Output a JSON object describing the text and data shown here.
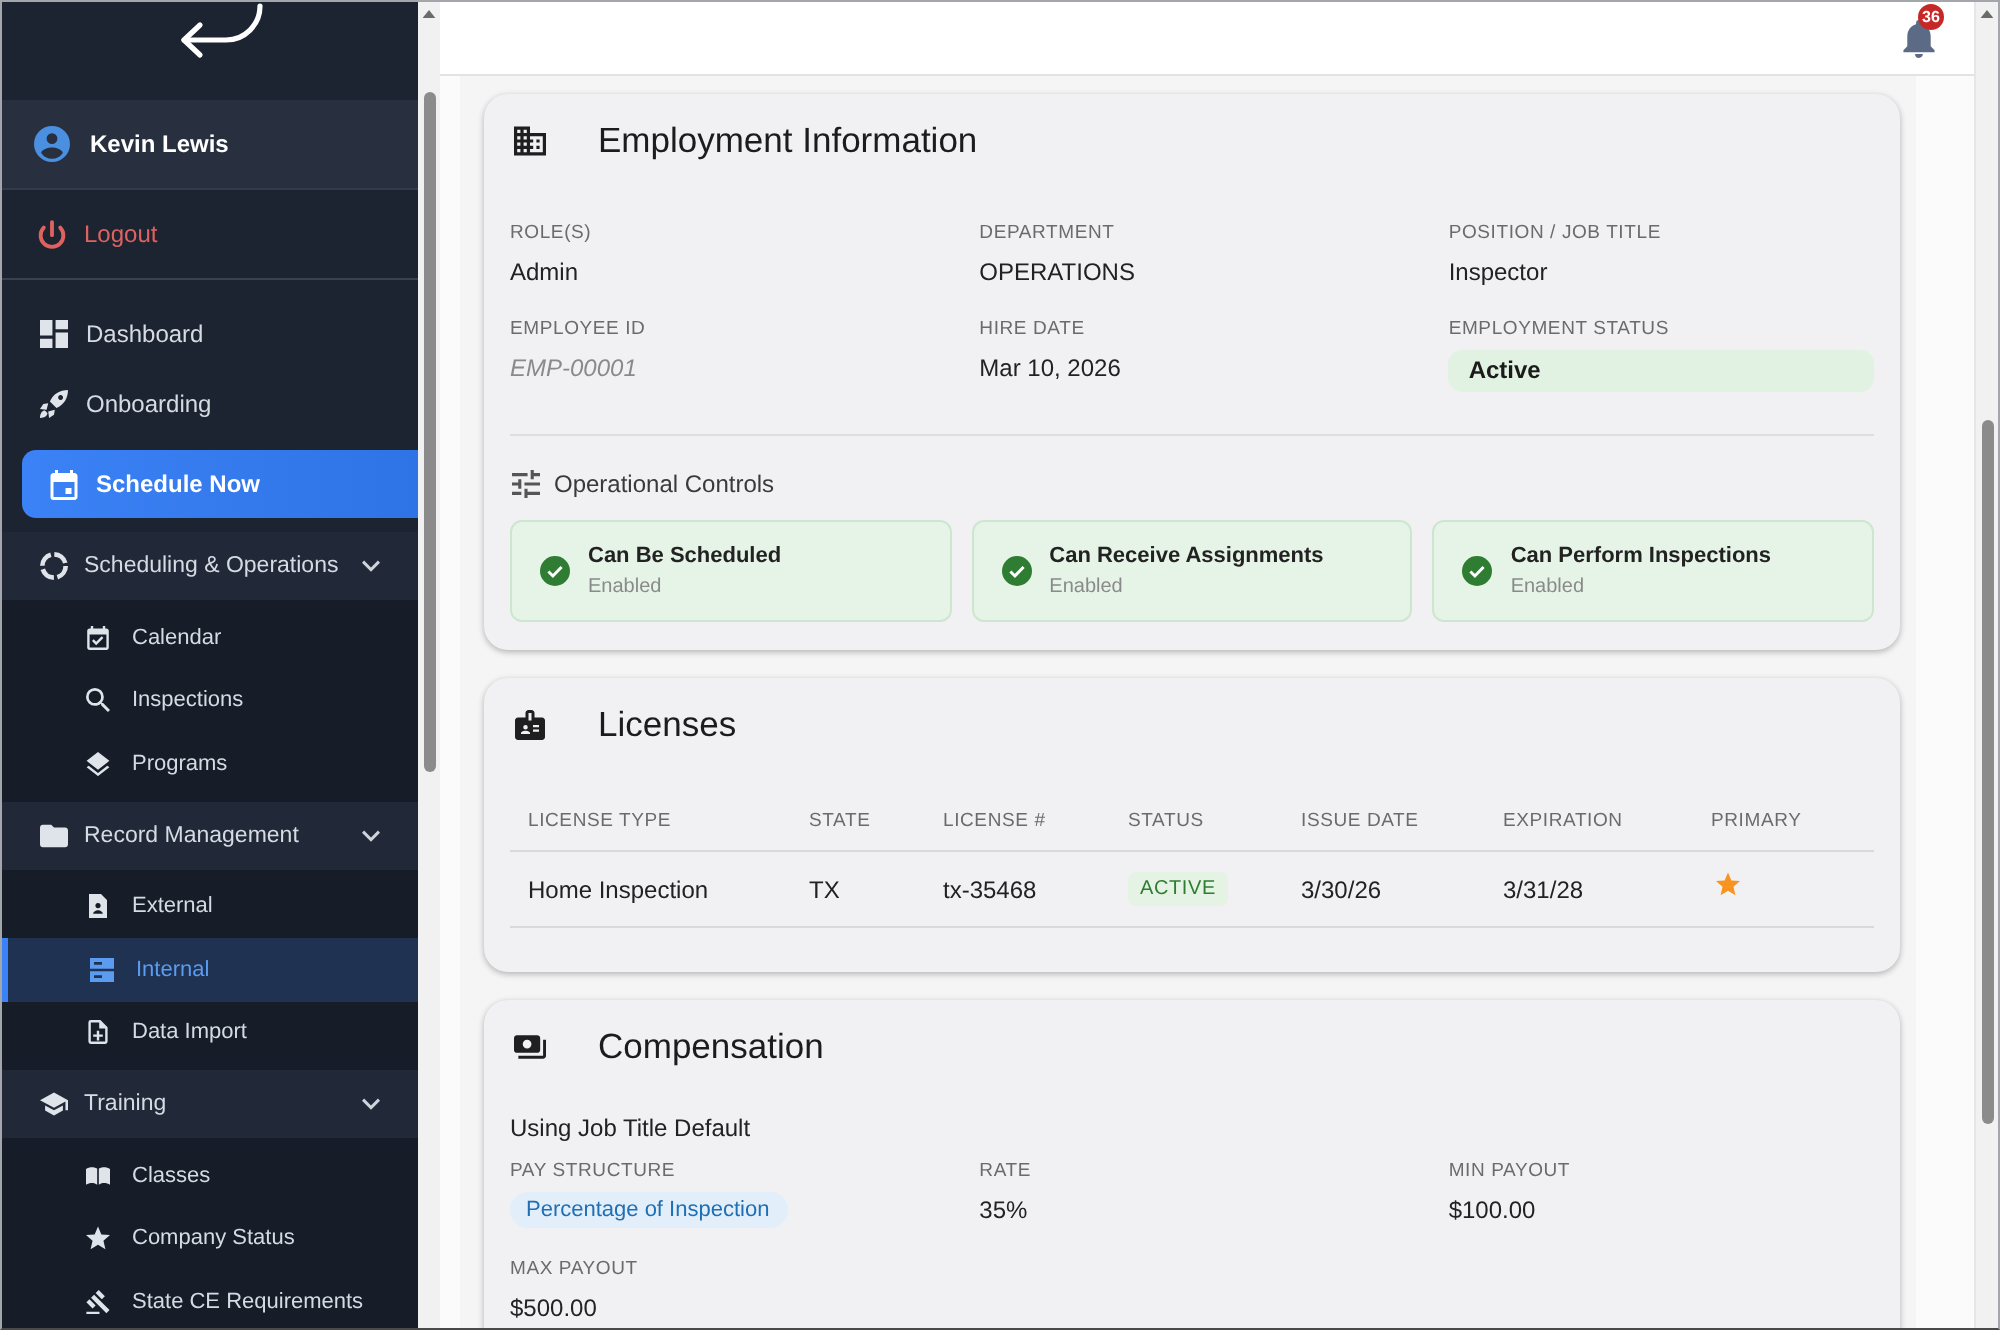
{
  "sidebar": {
    "user": {
      "name": "Kevin Lewis"
    },
    "logout": {
      "label": "Logout"
    },
    "items": [
      {
        "kind": "link",
        "label": "Dashboard",
        "selected": false
      },
      {
        "kind": "link",
        "label": "Onboarding",
        "selected": false
      },
      {
        "kind": "action",
        "label": "Schedule Now",
        "selected": false
      },
      {
        "kind": "group",
        "label": "Scheduling & Operations",
        "selected": false,
        "expanded": true,
        "children": [
          {
            "label": "Calendar",
            "selected": false
          },
          {
            "label": "Inspections",
            "selected": false
          },
          {
            "label": "Programs",
            "selected": false
          }
        ]
      },
      {
        "kind": "group",
        "label": "Record Management",
        "selected": false,
        "expanded": true,
        "children": [
          {
            "label": "External",
            "selected": false
          },
          {
            "label": "Internal",
            "selected": true
          },
          {
            "label": "Data Import",
            "selected": false
          }
        ]
      },
      {
        "kind": "group",
        "label": "Training",
        "selected": false,
        "expanded": true,
        "children": [
          {
            "label": "Classes",
            "selected": false
          },
          {
            "label": "Company Status",
            "selected": false
          },
          {
            "label": "State CE Requirements",
            "selected": false
          }
        ]
      }
    ]
  },
  "header": {
    "notification_count": "36"
  },
  "employment": {
    "title": "Employment Information",
    "fields": [
      {
        "label": "ROLE(S)",
        "value": "Admin",
        "kind": "text"
      },
      {
        "label": "DEPARTMENT",
        "value": "OPERATIONS",
        "kind": "text"
      },
      {
        "label": "POSITION / JOB TITLE",
        "value": "Inspector",
        "kind": "text"
      },
      {
        "label": "EMPLOYEE ID",
        "value": "EMP-00001",
        "kind": "muted"
      },
      {
        "label": "HIRE DATE",
        "value": "Mar 10, 2026",
        "kind": "text"
      },
      {
        "label": "EMPLOYMENT STATUS",
        "value": "Active",
        "kind": "badge"
      }
    ],
    "operational_controls": {
      "title": "Operational Controls",
      "items": [
        {
          "label": "Can Be Scheduled",
          "status": "Enabled",
          "enabled": true
        },
        {
          "label": "Can Receive Assignments",
          "status": "Enabled",
          "enabled": true
        },
        {
          "label": "Can Perform Inspections",
          "status": "Enabled",
          "enabled": true
        }
      ]
    }
  },
  "licenses": {
    "title": "Licenses",
    "columns": [
      "LICENSE TYPE",
      "STATE",
      "LICENSE #",
      "STATUS",
      "ISSUE DATE",
      "EXPIRATION",
      "PRIMARY"
    ],
    "rows": [
      {
        "license_type": "Home Inspection",
        "state": "TX",
        "license_number": "tx-35468",
        "status": "ACTIVE",
        "issue_date": "3/30/26",
        "expiration": "3/31/28",
        "primary": true
      }
    ]
  },
  "compensation": {
    "title": "Compensation",
    "note": "Using Job Title Default",
    "fields": [
      {
        "label": "PAY STRUCTURE",
        "value": "Percentage of Inspection",
        "kind": "chip"
      },
      {
        "label": "RATE",
        "value": "35%",
        "kind": "text"
      },
      {
        "label": "MIN PAYOUT",
        "value": "$100.00",
        "kind": "text"
      },
      {
        "label": "MAX PAYOUT",
        "value": "$500.00",
        "kind": "text"
      }
    ]
  }
}
